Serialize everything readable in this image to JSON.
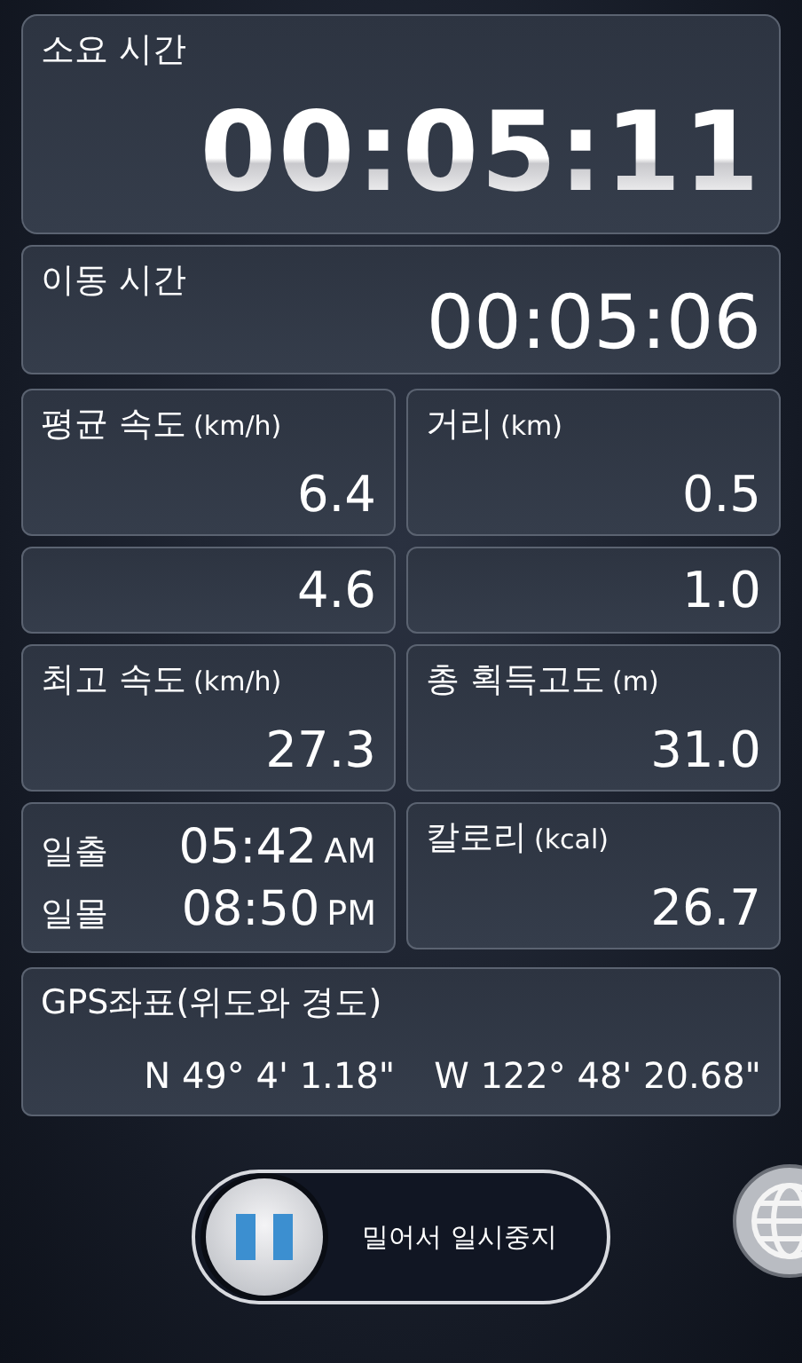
{
  "elapsed": {
    "label": "소요 시간",
    "value": "00:05:11"
  },
  "moving": {
    "label": "이동 시간",
    "value": "00:05:06"
  },
  "stats": [
    {
      "label": "평균 속도",
      "unit": "(km/h)",
      "value": "6.4"
    },
    {
      "label": "거리",
      "unit": "(km)",
      "value": "0.5"
    },
    {
      "value": "4.6"
    },
    {
      "value": "1.0"
    },
    {
      "label": "최고 속도",
      "unit": "(km/h)",
      "value": "27.3"
    },
    {
      "label": "총 획득고도",
      "unit": "(m)",
      "value": "31.0"
    }
  ],
  "sun": [
    {
      "label": "일출",
      "time": "05:42",
      "period": "AM"
    },
    {
      "label": "일몰",
      "time": "08:50",
      "period": "PM"
    }
  ],
  "calories": {
    "label": "칼로리",
    "unit": "(kcal)",
    "value": "26.7"
  },
  "gps": {
    "label": "GPS좌표(위도와 경도)",
    "latitude": "N 49° 4' 1.18\"",
    "longitude": "W 122° 48' 20.68\""
  },
  "pause_slider": {
    "label": "밀어서 일시중지",
    "level": 0
  }
}
